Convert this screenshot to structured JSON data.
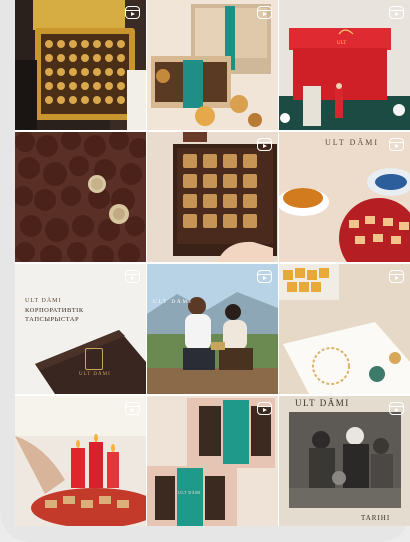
{
  "feed": {
    "tiles": [
      {
        "id": "tile-1",
        "alt": "golden chocolate box",
        "reel": true
      },
      {
        "id": "tile-2",
        "alt": "chocolate gift box",
        "reel": true
      },
      {
        "id": "tile-3",
        "alt": "red gift box",
        "reel": true
      },
      {
        "id": "tile-4",
        "alt": "chocolate truffles",
        "reel": false
      },
      {
        "id": "tile-5",
        "alt": "box of chocolates",
        "reel": true
      },
      {
        "id": "tile-6",
        "alt": "tea and chocolates",
        "reel": true
      },
      {
        "id": "tile-7",
        "alt": "corporate orders",
        "reel": true
      },
      {
        "id": "tile-8",
        "alt": "couple picnic",
        "reel": true
      },
      {
        "id": "tile-9",
        "alt": "sweets and paper",
        "reel": true
      },
      {
        "id": "tile-10",
        "alt": "candles and sweets",
        "reel": true
      },
      {
        "id": "tile-11",
        "alt": "gift boxes",
        "reel": true
      },
      {
        "id": "tile-12",
        "alt": "historic photo",
        "reel": true
      }
    ]
  },
  "texts": {
    "tile6_brand": "ULT DĀMI",
    "tile7_brand": "ULT DĀMI",
    "tile7_title": "КОРПОРАТИВТІК ТАПСЫРЫСТАР",
    "tile7_logo": "ULT DĀMI",
    "tile8_brand": "ULT DĀMI",
    "tile12_brand": "ULT DĀMI",
    "tile12_sub": "TARIHI",
    "tile11_box": "ULT DĀMI"
  },
  "colors": {
    "accent_teal": "#1f9a8a",
    "gold": "#c9a45c",
    "red_box": "#d8262e"
  },
  "icons": {
    "reel": "reel-icon"
  }
}
